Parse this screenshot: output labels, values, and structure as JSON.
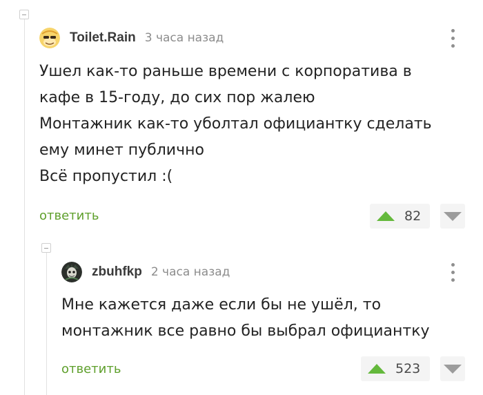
{
  "comments": [
    {
      "username": "Toilet.Rain",
      "time": "3 часа назад",
      "text": "Ушел как-то раньше времени с корпоратива в\nкафе в 15-году, до сих пор жалею\nМонтажник как-то уболтал официантку сделать\nему минет публично\nВсё пропустил :(",
      "reply_label": "ответить",
      "score": "82",
      "avatar_icon": "cartoon-face-icon"
    },
    {
      "username": "zbuhfkp",
      "time": "2 часа назад",
      "text": "Мне кажется даже если бы не ушёл, то\nмонтажник все равно бы выбрал официантку",
      "reply_label": "ответить",
      "score": "523",
      "avatar_icon": "dark-character-icon"
    }
  ],
  "colors": {
    "reply": "#5e9f2b",
    "upvote": "#64b93c",
    "downvote": "#9c9c9c",
    "thread_line": "#e1e1e1"
  }
}
